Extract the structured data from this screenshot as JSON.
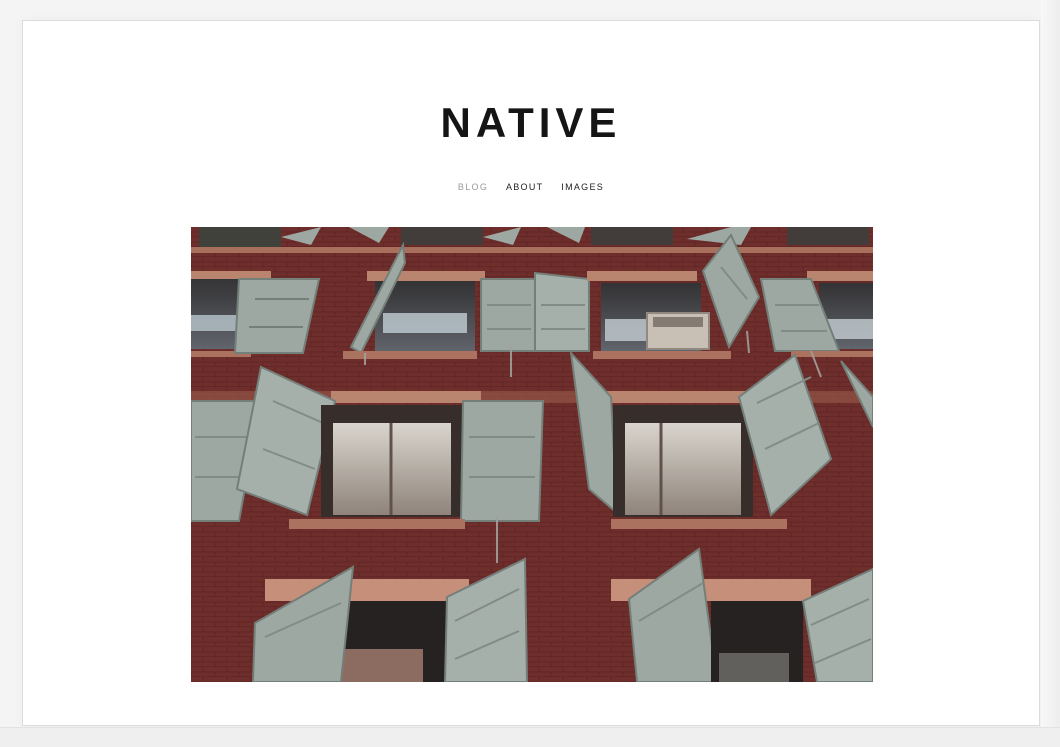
{
  "site": {
    "title": "NATIVE"
  },
  "nav": {
    "items": [
      {
        "label": "BLOG",
        "active": true
      },
      {
        "label": "ABOUT",
        "active": false
      },
      {
        "label": "IMAGES",
        "active": false
      }
    ]
  },
  "hero": {
    "alt": "Red brick building facade with open grey wooden shutters",
    "colors": {
      "brick": "#772d2a",
      "brick_dark": "#5b1f1d",
      "shutter": "#9aa59f",
      "shutter_dark": "#6f7a75",
      "sill": "#b8806a"
    }
  }
}
